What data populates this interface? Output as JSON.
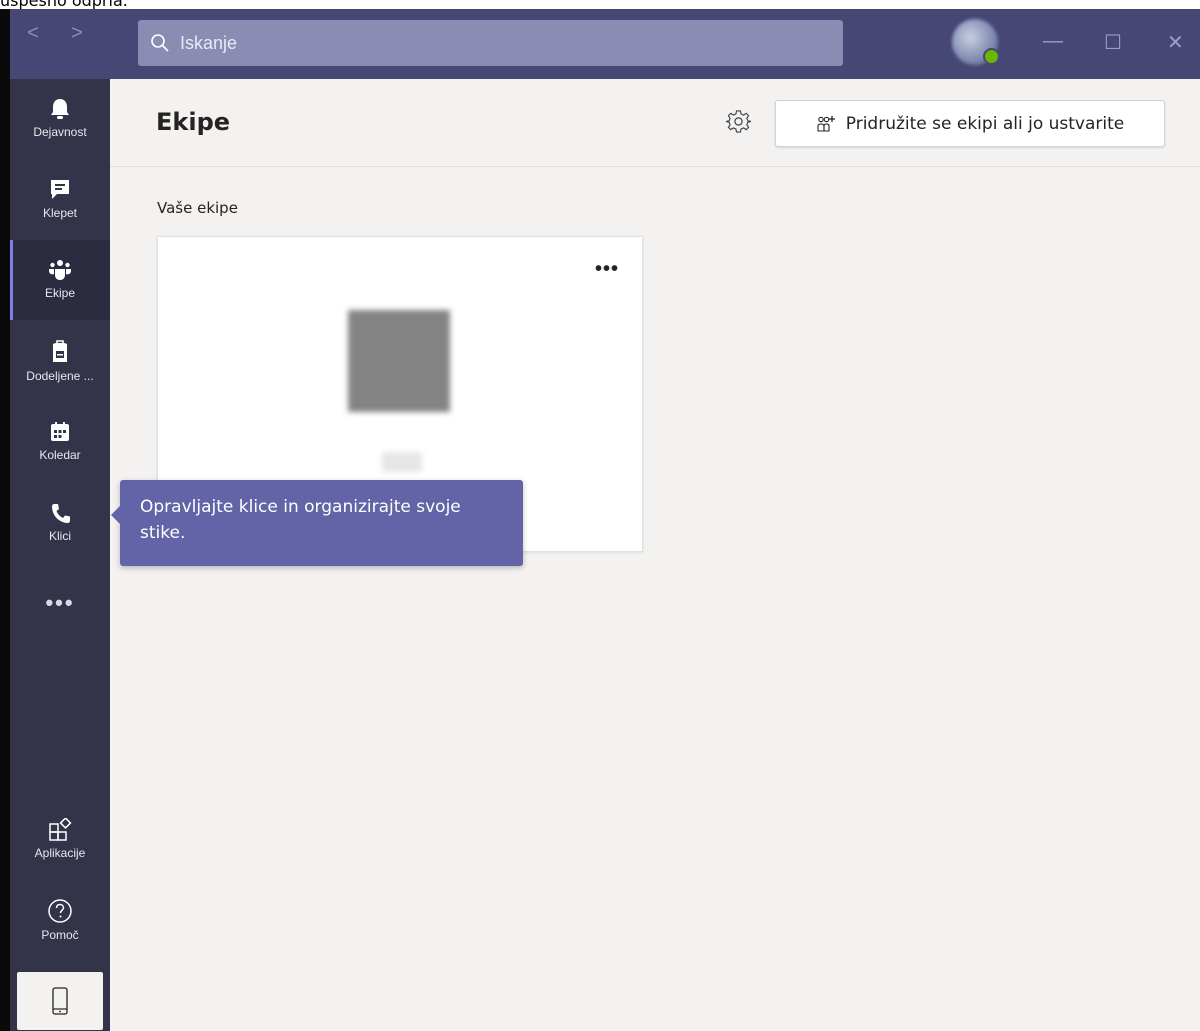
{
  "caption": "uspešno odpria.",
  "search": {
    "placeholder": "Iskanje"
  },
  "window_controls": {
    "minimize": "—",
    "maximize": "☐",
    "close": "✕"
  },
  "nav": {
    "back": "<",
    "forward": ">"
  },
  "rail": {
    "items": [
      {
        "label": "Dejavnost",
        "icon": "bell-icon"
      },
      {
        "label": "Klepet",
        "icon": "chat-icon"
      },
      {
        "label": "Ekipe",
        "icon": "teams-icon",
        "active": true
      },
      {
        "label": "Dodeljene ...",
        "icon": "assignments-icon"
      },
      {
        "label": "Koledar",
        "icon": "calendar-icon"
      },
      {
        "label": "Klici",
        "icon": "phone-icon"
      }
    ],
    "more": "•••",
    "bottom": [
      {
        "label": "Aplikacije",
        "icon": "apps-icon"
      },
      {
        "label": "Pomoč",
        "icon": "help-icon"
      }
    ]
  },
  "header": {
    "title": "Ekipe",
    "join_button": "Pridružite se ekipi ali jo ustvarite"
  },
  "main": {
    "section_label": "Vaše ekipe",
    "card_more": "•••"
  },
  "tooltip": {
    "text": "Opravljajte klice in organizirajte svoje stike."
  },
  "colors": {
    "titlebar": "#464775",
    "rail": "#33344a",
    "accent": "#6264a7",
    "background": "#f3f2f1"
  }
}
